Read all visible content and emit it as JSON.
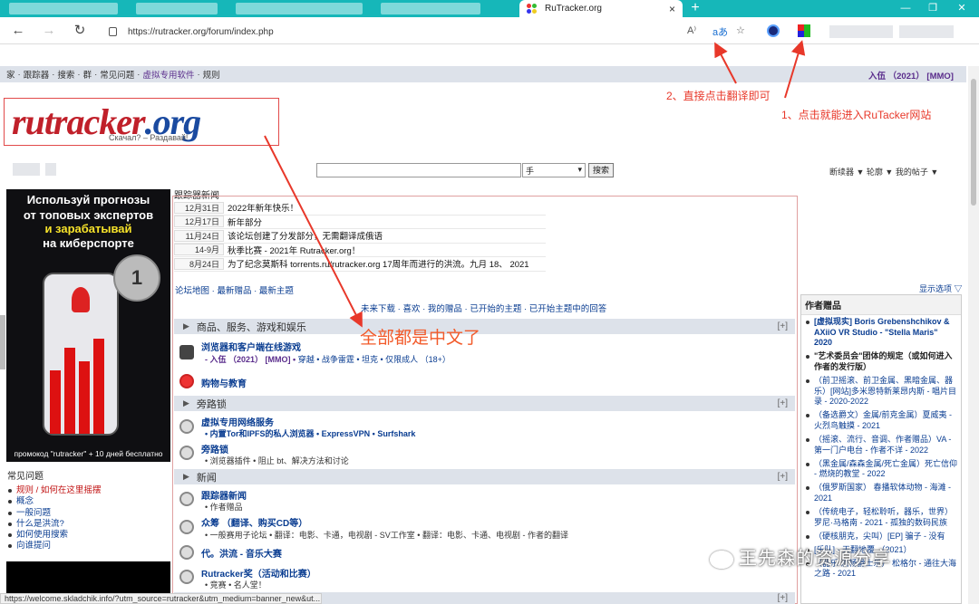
{
  "browser": {
    "tab_title": "RuTracker.org",
    "url": "https://rutracker.org/forum/index.php",
    "new_tab": "+",
    "close_tab": "×",
    "translate_icon": "aあ",
    "reader_icon": "A)",
    "fav_icon": "☆"
  },
  "topnav": {
    "items": [
      "家",
      "·",
      "跟踪器",
      "·",
      "搜索",
      "·",
      "群",
      "·",
      "常见问题",
      "·"
    ],
    "purple_item": "虚拟专用软件",
    "rules": "规则",
    "login": "入伍 （2021）  [MMO]"
  },
  "logo": {
    "word1": "rutracker",
    "word2": ".org",
    "tagline": "Скачал? – Раздавай!"
  },
  "search": {
    "select_value": "手",
    "button": "搜索"
  },
  "right_links": "断续器 ▼   轮廓 ▼   我的帖子 ▼",
  "banner": {
    "line1": "Используй прогнозы",
    "line2": "от топовых экспертов",
    "line3": "и зарабатывай",
    "line4": "на киберспорте",
    "coin": "1",
    "footer": "промокод \"rutracker\" + 10 дней бесплатно"
  },
  "faq": {
    "title": "常见问题",
    "items": [
      "规则 / 如何在这里摇摆",
      "概念",
      "一般问题",
      "什么是洪流?",
      "如何使用搜索",
      "向谁提问"
    ]
  },
  "news": {
    "title": "跟踪器新闻",
    "rows": [
      {
        "date": "12月31日",
        "text": "2022年新年快乐！"
      },
      {
        "date": "12月17日",
        "text": "新年部分"
      },
      {
        "date": "11月24日",
        "text": "该论坛创建了分发部分，无需翻译成俄语"
      },
      {
        "date": "14-9月",
        "text": "秋季比赛 - 2021年 Rutracker.org！"
      },
      {
        "date": "8月24日",
        "text": "为了纪念莫斯科 torrents.ru/rutracker.org 17周年而进行的洪流。九月 18、 2021"
      }
    ],
    "links": "论坛地图 · 最新赠品 · 最新主题",
    "downloads": "未来下载 · 喜欢 · 我的赠品 · 已开始的主题 · 已开始主题中的回答"
  },
  "forum": {
    "cat1": "商品、服务、游戏和娱乐",
    "f1_title": "浏览器和客户端在线游戏",
    "f1_sub_pre": "- 入伍 （2021） [MMO] •",
    "f1_sub_rest": "穿越 • 战争雷霆 • 坦克 • 仅限成人 （18+）",
    "f2_title": "购物与教育",
    "cat2": "旁路锁",
    "f3_title": "虚拟专用网络服务",
    "f3_sub": "• 内置Tor和IPFS的私人浏览器 • ExpressVPN • Surfshark",
    "f4_title": "旁路锁",
    "f4_sub": "• 浏览器插件 • 阻止 bt、解决方法和讨论",
    "cat3": "新闻",
    "f5_title": "跟踪器新闻",
    "f5_sub": "• 作者赠品",
    "f6_title": "众筹 （翻译、购买CD等）",
    "f6_sub": "• 一般赛用子论坛 • 翻译：电影、卡通，电视剧 - SV工作室 • 翻译：电影、卡通、电视剧 - 作者的翻译",
    "f7_title": "代。洪流 - 音乐大赛",
    "f8_title": "Rutracker奖（活动和比赛）",
    "f8_sub": "• 竞赛 • 名人堂！",
    "plus": "[+]"
  },
  "right": {
    "show_options": "显示选项 ▽",
    "title": "作者赠品",
    "items": [
      "[虚拟现实] Boris Grebenshchikov & AXiiO VR Studio - \"Stella Maris\" 2020",
      "\"艺术委员会\"团体的规定（或如何进入作者的发行版）",
      "（前卫摇滚、前卫金属、黑暗金属、器乐）[网站]多米恩特新莱昂内斯 - 唱片目录 - 2020-2022",
      "（备选爵文）金属/前克金属）夏威夷 - 火烈鸟触摸 - 2021",
      "（摇滚、流行、音调、作者赠品）VA - 第一门户电台 - 作者不详 - 2022",
      "（黑金属/森森金属/死亡金属）死亡信仰 - 燃烧的教堂 - 2022",
      "（俄罗斯国家） 春播软体动物 - 海滩 - 2021",
      "（传统电子，轻松聆听，器乐，世界）罗尼·马格南 - 2021 - 孤独的数码民族",
      "（硬核朋克，尖叫）[EP] 骗子 - 没有",
      "[乐队] - 天翻地覆 （2021）",
      "（器乐/流畅爵士乐） 松格尔 - 通往大海之路 - 2021"
    ]
  },
  "annotations": {
    "note1": "1、点击就能进入RuTacker网站",
    "note2": "2、直接点击翻译即可",
    "note3": "全部都是中文了",
    "watermark": "王先森的资源分享"
  },
  "status": "https://welcome.skladchik.info/?utm_source=rutracker&utm_medium=banner_new&ut..."
}
